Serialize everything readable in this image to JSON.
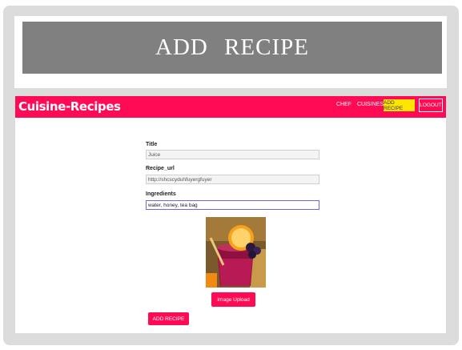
{
  "slide": {
    "title": "ADD   RECIPE"
  },
  "app": {
    "brand": "Cuisine-Recipes",
    "nav": {
      "chef": "CHEF",
      "cuisines": "CUISINES",
      "add_recipe": "ADD RECIPE",
      "logout": "LOGOUT"
    },
    "form": {
      "title_label": "Title",
      "title_value": "Juice",
      "url_label": "Recipe_url",
      "url_value": "http://shcscyduhfuyergfuyer",
      "ingredients_label": "Ingredients",
      "ingredients_value": "water, honey, tea bag",
      "image_upload_button": "Image Upload",
      "submit_button": "ADD RECIPE"
    },
    "colors": {
      "primary": "#ff0a54",
      "active_nav": "#ffe500",
      "title_bar": "#808080"
    }
  }
}
